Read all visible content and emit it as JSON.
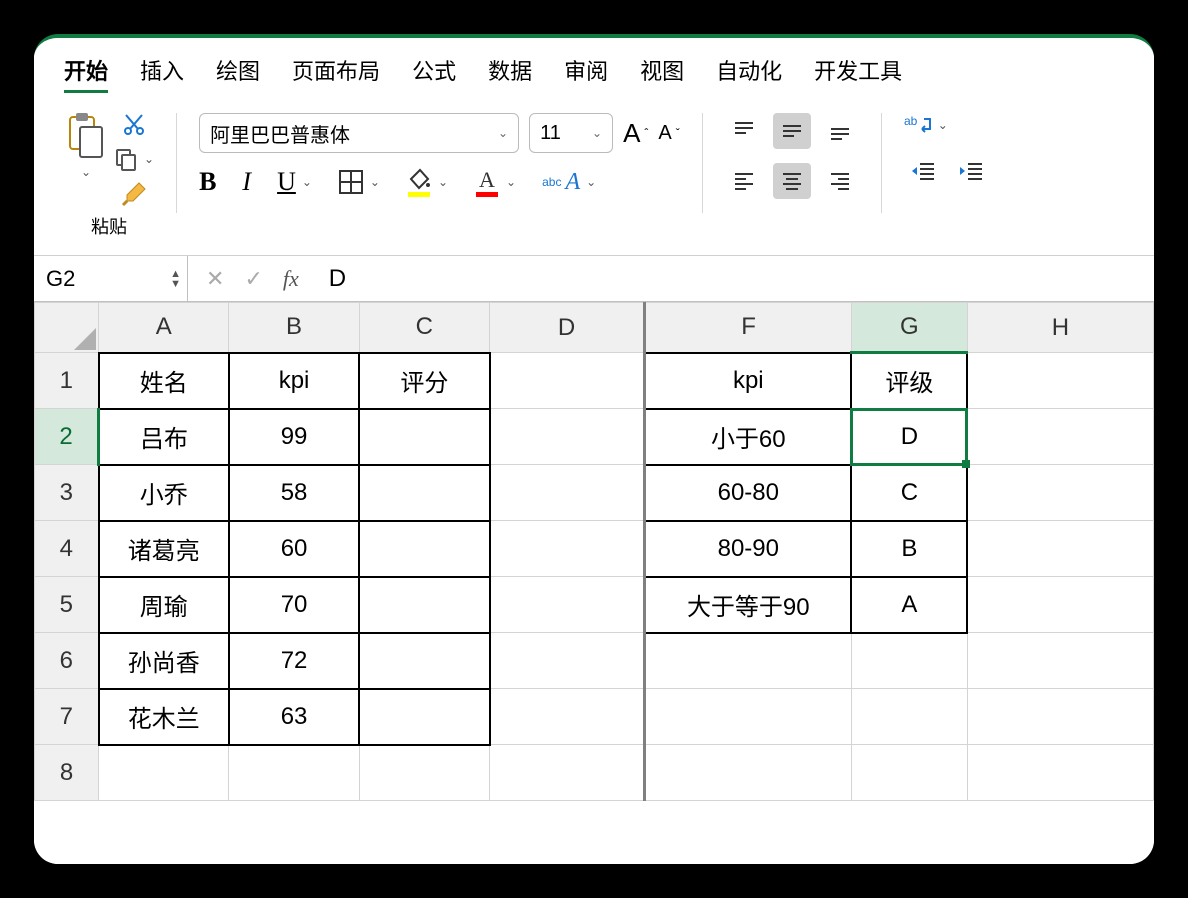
{
  "tabs": [
    "开始",
    "插入",
    "绘图",
    "页面布局",
    "公式",
    "数据",
    "审阅",
    "视图",
    "自动化",
    "开发工具"
  ],
  "active_tab": 0,
  "clipboard": {
    "paste_label": "粘贴"
  },
  "font": {
    "name": "阿里巴巴普惠体",
    "size": "11"
  },
  "namebox": "G2",
  "formula_bar": "D",
  "columns": [
    "A",
    "B",
    "C",
    "D",
    "F",
    "G",
    "H"
  ],
  "rows": [
    "1",
    "2",
    "3",
    "4",
    "5",
    "6",
    "7",
    "8"
  ],
  "selected_cell": "G2",
  "cells": {
    "A1": "姓名",
    "B1": "kpi",
    "C1": "评分",
    "F1": "kpi",
    "G1": "评级",
    "A2": "吕布",
    "B2": "99",
    "F2": "小于60",
    "G2": "D",
    "A3": "小乔",
    "B3": "58",
    "F3": "60-80",
    "G3": "C",
    "A4": "诸葛亮",
    "B4": "60",
    "F4": "80-90",
    "G4": "B",
    "A5": "周瑜",
    "B5": "70",
    "F5": "大于等于90",
    "G5": "A",
    "A6": "孙尚香",
    "B6": "72",
    "A7": "花木兰",
    "B7": "63"
  }
}
